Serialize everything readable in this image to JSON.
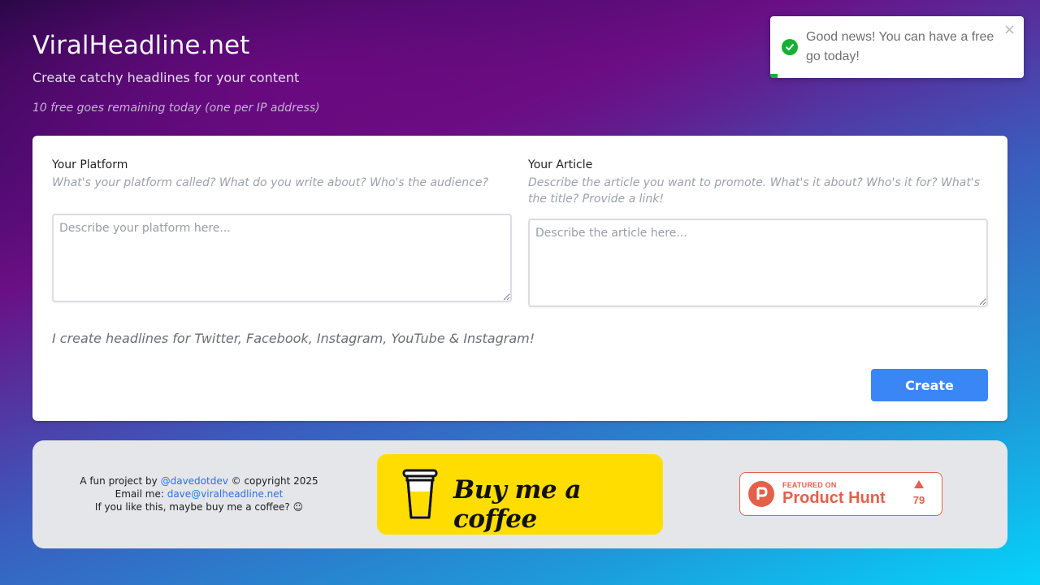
{
  "header": {
    "title": "ViralHeadline.net",
    "subtitle": "Create catchy headlines for your content",
    "free_note": "10 free goes remaining today (one per IP address)"
  },
  "toast": {
    "message": "Good news! You can have a free go today!",
    "close_label": "×",
    "icon": "check-circle-icon",
    "color": "#15b035",
    "progress": 0.03
  },
  "form": {
    "platform": {
      "label": "Your Platform",
      "help": "What's your platform called? What do you write about? Who's the audience?",
      "placeholder": "Describe your platform here...",
      "value": ""
    },
    "article": {
      "label": "Your Article",
      "help": "Describe the article you want to promote. What's it about? Who's it for? What's the title? Provide a link!",
      "placeholder": "Describe the article here...",
      "value": ""
    },
    "platforms_note": "I create headlines for Twitter, Facebook, Instagram, YouTube & Instagram!",
    "create_label": "Create",
    "accent": "#3a86f6"
  },
  "footer": {
    "line1_prefix": "A fun project by ",
    "handle": "@davedotdev",
    "line1_suffix": " © copyright 2025",
    "email_prefix": "Email me:  ",
    "email": "dave@viralheadline.net",
    "line3": "If you like this, maybe buy me a coffee? ☺",
    "coffee_label": "Buy me a coffee",
    "coffee_color": "#ffdd00",
    "producthunt": {
      "featured": "FEATURED ON",
      "name": "Product Hunt",
      "votes": "79",
      "color": "#e4604a"
    }
  }
}
